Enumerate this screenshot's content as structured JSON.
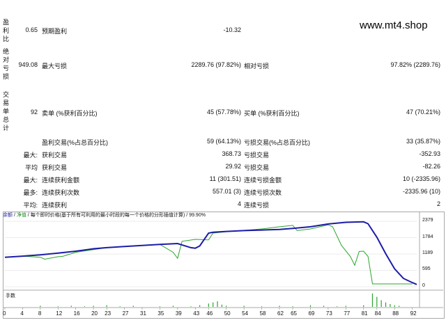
{
  "watermark": "www.mt4.shop",
  "side_labels": [
    "盈利比",
    "绝对亏损",
    "交易单总计"
  ],
  "stats": [
    {
      "c1": "0.65",
      "l2": "预期盈利",
      "v2": "-10.32",
      "l3": "",
      "v3": ""
    },
    {
      "c1": "949.08",
      "l2": "最大亏损",
      "v2": "2289.76 (97.82%)",
      "l3": "相对亏损",
      "v3": "97.82% (2289.76)"
    },
    {
      "c1": "92",
      "l2": "卖单 (%获利百分比)",
      "v2": "45 (57.78%)",
      "l3": "买单 (%获利百分比)",
      "v3": "47 (70.21%)"
    },
    {
      "c1": "",
      "l2": "盈利交易(%占总百分比)",
      "v2": "59 (64.13%)",
      "l3": "亏损交易(%占总百分比)",
      "v3": "33 (35.87%)"
    },
    {
      "c1": "最大:",
      "l2": "获利交易",
      "v2": "368.73",
      "l3": "亏损交易",
      "v3": "-352.93"
    },
    {
      "c1": "平均",
      "l2": "获利交易",
      "v2": "29.92",
      "l3": "亏损交易",
      "v3": "-82.26"
    },
    {
      "c1": "最大:",
      "l2": "连续获利金额",
      "v2": "11 (301.51)",
      "l3": "连续亏损金额",
      "v3": "10 (-2335.96)"
    },
    {
      "c1": "最多:",
      "l2": "连续获利次数",
      "v2": "557.01 (3)",
      "l3": "连续亏损次数",
      "v3": "-2335.96 (10)"
    },
    {
      "c1": "平均:",
      "l2": "连续获利",
      "v2": "4",
      "l3": "连续亏损",
      "v3": "2"
    }
  ],
  "chart_header": {
    "balance": "余额",
    "equity": "净值",
    "desc": "每个即时价格(基于所有可利用的最小时段的每一个价格的分形插值计算)",
    "quality": "99.90%"
  },
  "volume_label": "手数",
  "colors": {
    "balance": "#1c1ca8",
    "equity": "#2aa52a",
    "volume": "#2aa52a",
    "grid": "#d8d8d8"
  },
  "chart_data": {
    "type": "line",
    "x_ticks": [
      "0",
      "4",
      "8",
      "12",
      "16",
      "20",
      "23",
      "27",
      "31",
      "35",
      "39",
      "43",
      "46",
      "50",
      "54",
      "58",
      "62",
      "65",
      "69",
      "73",
      "77",
      "81",
      "84",
      "88",
      "92"
    ],
    "y_ticks": [
      "2379",
      "1784",
      "1189",
      "595",
      "0"
    ],
    "ylim": [
      0,
      2379
    ],
    "series": [
      {
        "name": "余额",
        "x": [
          0,
          4,
          8,
          12,
          16,
          20,
          23,
          27,
          31,
          35,
          39,
          42,
          43,
          44,
          46,
          47,
          50,
          54,
          58,
          62,
          65,
          69,
          73,
          77,
          81,
          82,
          84,
          86,
          88,
          90,
          92,
          93
        ],
        "y": [
          1070,
          1110,
          1160,
          1220,
          1290,
          1380,
          1420,
          1460,
          1500,
          1540,
          1570,
          1420,
          1400,
          1480,
          1950,
          1980,
          2010,
          2040,
          2060,
          2080,
          2120,
          2180,
          2280,
          2340,
          2360,
          2290,
          1800,
          1200,
          650,
          300,
          150,
          80
        ]
      },
      {
        "name": "净值",
        "x": [
          0,
          4,
          8,
          9,
          12,
          13,
          16,
          20,
          23,
          27,
          31,
          35,
          38,
          39,
          40,
          43,
          46,
          47,
          50,
          54,
          58,
          62,
          65,
          66,
          69,
          73,
          74,
          76,
          78,
          79,
          80,
          81,
          82,
          83,
          84,
          88,
          92
        ],
        "y": [
          1070,
          1110,
          1070,
          1000,
          1090,
          1100,
          1250,
          1350,
          1420,
          1460,
          1500,
          1540,
          1250,
          1030,
          1650,
          1720,
          1700,
          1950,
          2000,
          2050,
          2100,
          2180,
          2230,
          2040,
          2100,
          2250,
          2180,
          1500,
          1100,
          780,
          1280,
          1290,
          1100,
          100,
          100,
          100,
          100
        ]
      }
    ],
    "volume": {
      "x": [
        8,
        12,
        15,
        18,
        20,
        23,
        26,
        29,
        35,
        38,
        42,
        44,
        46,
        47,
        48,
        49,
        50,
        54,
        58,
        62,
        65,
        69,
        72,
        75,
        77,
        81,
        83,
        84,
        85,
        86,
        87,
        88,
        89
      ],
      "y": [
        0.2,
        0.1,
        0.2,
        0.1,
        0.2,
        0.3,
        0.1,
        0.2,
        0.1,
        0.2,
        0.1,
        0.3,
        0.6,
        0.8,
        1.0,
        0.4,
        0.2,
        0.2,
        0.1,
        0.2,
        0.1,
        0.3,
        0.2,
        0.1,
        0.2,
        0.3,
        2.4,
        1.8,
        1.2,
        0.8,
        0.5,
        0.3,
        0.2
      ]
    }
  }
}
